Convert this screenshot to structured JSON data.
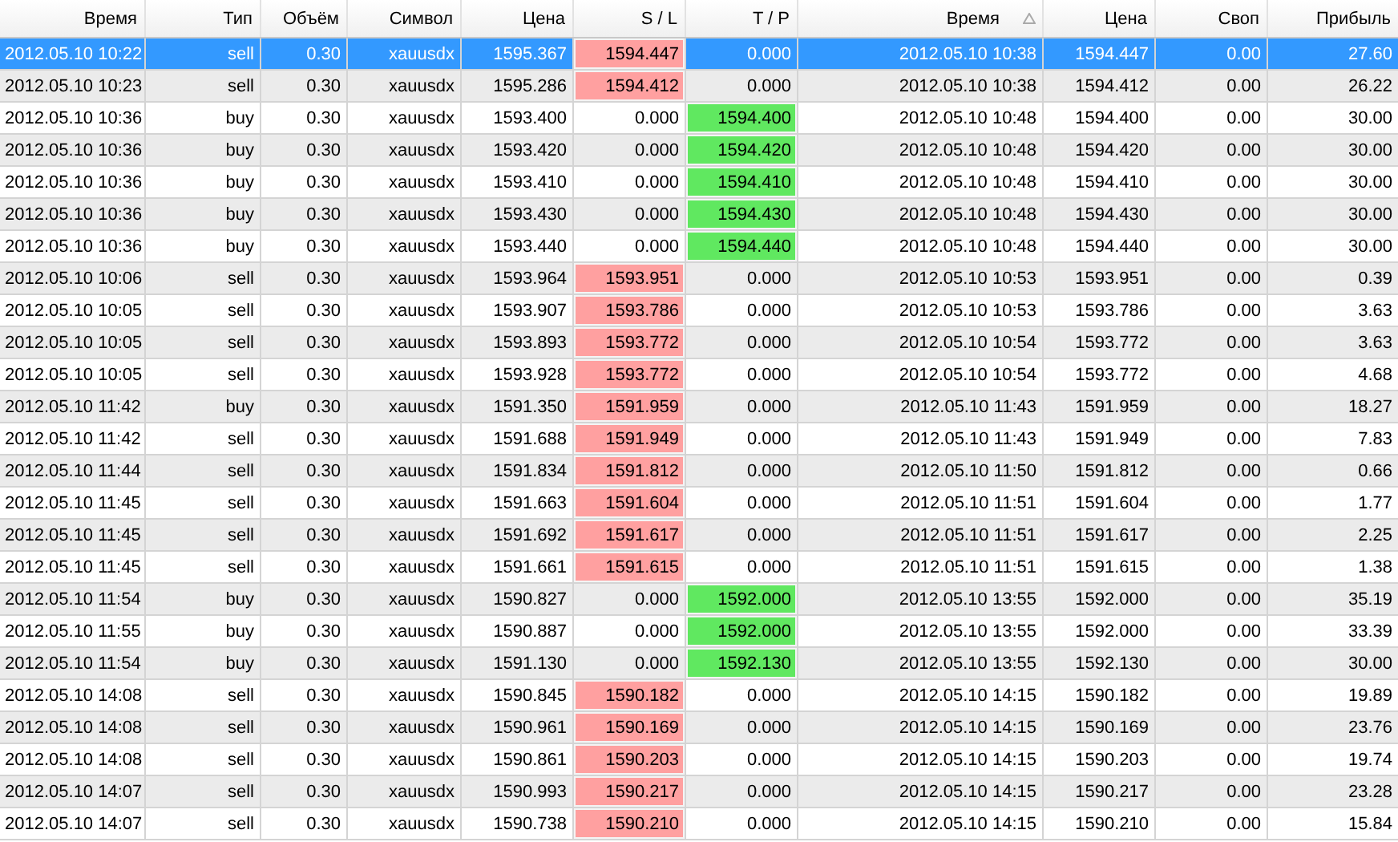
{
  "table": {
    "columns": [
      {
        "label": "Время",
        "sorted": false
      },
      {
        "label": "Тип",
        "sorted": false
      },
      {
        "label": "Объём",
        "sorted": false
      },
      {
        "label": "Символ",
        "sorted": false
      },
      {
        "label": "Цена",
        "sorted": false
      },
      {
        "label": "S / L",
        "sorted": false
      },
      {
        "label": "T / P",
        "sorted": false
      },
      {
        "label": "Время",
        "sorted": true
      },
      {
        "label": "Цена",
        "sorted": false
      },
      {
        "label": "Своп",
        "sorted": false
      },
      {
        "label": "Прибыль",
        "sorted": false
      }
    ],
    "rows": [
      {
        "cells": [
          "2012.05.10 10:22",
          "sell",
          "0.30",
          "xauusdx",
          "1595.367",
          "1594.447",
          "0.000",
          "2012.05.10 10:38",
          "1594.447",
          "0.00",
          "27.60"
        ],
        "selected": true,
        "sl_set": true,
        "tp_set": false
      },
      {
        "cells": [
          "2012.05.10 10:23",
          "sell",
          "0.30",
          "xauusdx",
          "1595.286",
          "1594.412",
          "0.000",
          "2012.05.10 10:38",
          "1594.412",
          "0.00",
          "26.22"
        ],
        "selected": false,
        "sl_set": true,
        "tp_set": false
      },
      {
        "cells": [
          "2012.05.10 10:36",
          "buy",
          "0.30",
          "xauusdx",
          "1593.400",
          "0.000",
          "1594.400",
          "2012.05.10 10:48",
          "1594.400",
          "0.00",
          "30.00"
        ],
        "selected": false,
        "sl_set": false,
        "tp_set": true
      },
      {
        "cells": [
          "2012.05.10 10:36",
          "buy",
          "0.30",
          "xauusdx",
          "1593.420",
          "0.000",
          "1594.420",
          "2012.05.10 10:48",
          "1594.420",
          "0.00",
          "30.00"
        ],
        "selected": false,
        "sl_set": false,
        "tp_set": true
      },
      {
        "cells": [
          "2012.05.10 10:36",
          "buy",
          "0.30",
          "xauusdx",
          "1593.410",
          "0.000",
          "1594.410",
          "2012.05.10 10:48",
          "1594.410",
          "0.00",
          "30.00"
        ],
        "selected": false,
        "sl_set": false,
        "tp_set": true
      },
      {
        "cells": [
          "2012.05.10 10:36",
          "buy",
          "0.30",
          "xauusdx",
          "1593.430",
          "0.000",
          "1594.430",
          "2012.05.10 10:48",
          "1594.430",
          "0.00",
          "30.00"
        ],
        "selected": false,
        "sl_set": false,
        "tp_set": true
      },
      {
        "cells": [
          "2012.05.10 10:36",
          "buy",
          "0.30",
          "xauusdx",
          "1593.440",
          "0.000",
          "1594.440",
          "2012.05.10 10:48",
          "1594.440",
          "0.00",
          "30.00"
        ],
        "selected": false,
        "sl_set": false,
        "tp_set": true
      },
      {
        "cells": [
          "2012.05.10 10:06",
          "sell",
          "0.30",
          "xauusdx",
          "1593.964",
          "1593.951",
          "0.000",
          "2012.05.10 10:53",
          "1593.951",
          "0.00",
          "0.39"
        ],
        "selected": false,
        "sl_set": true,
        "tp_set": false
      },
      {
        "cells": [
          "2012.05.10 10:05",
          "sell",
          "0.30",
          "xauusdx",
          "1593.907",
          "1593.786",
          "0.000",
          "2012.05.10 10:53",
          "1593.786",
          "0.00",
          "3.63"
        ],
        "selected": false,
        "sl_set": true,
        "tp_set": false
      },
      {
        "cells": [
          "2012.05.10 10:05",
          "sell",
          "0.30",
          "xauusdx",
          "1593.893",
          "1593.772",
          "0.000",
          "2012.05.10 10:54",
          "1593.772",
          "0.00",
          "3.63"
        ],
        "selected": false,
        "sl_set": true,
        "tp_set": false
      },
      {
        "cells": [
          "2012.05.10 10:05",
          "sell",
          "0.30",
          "xauusdx",
          "1593.928",
          "1593.772",
          "0.000",
          "2012.05.10 10:54",
          "1593.772",
          "0.00",
          "4.68"
        ],
        "selected": false,
        "sl_set": true,
        "tp_set": false
      },
      {
        "cells": [
          "2012.05.10 11:42",
          "buy",
          "0.30",
          "xauusdx",
          "1591.350",
          "1591.959",
          "0.000",
          "2012.05.10 11:43",
          "1591.959",
          "0.00",
          "18.27"
        ],
        "selected": false,
        "sl_set": true,
        "tp_set": false
      },
      {
        "cells": [
          "2012.05.10 11:42",
          "sell",
          "0.30",
          "xauusdx",
          "1591.688",
          "1591.949",
          "0.000",
          "2012.05.10 11:43",
          "1591.949",
          "0.00",
          "7.83"
        ],
        "selected": false,
        "sl_set": true,
        "tp_set": false
      },
      {
        "cells": [
          "2012.05.10 11:44",
          "sell",
          "0.30",
          "xauusdx",
          "1591.834",
          "1591.812",
          "0.000",
          "2012.05.10 11:50",
          "1591.812",
          "0.00",
          "0.66"
        ],
        "selected": false,
        "sl_set": true,
        "tp_set": false
      },
      {
        "cells": [
          "2012.05.10 11:45",
          "sell",
          "0.30",
          "xauusdx",
          "1591.663",
          "1591.604",
          "0.000",
          "2012.05.10 11:51",
          "1591.604",
          "0.00",
          "1.77"
        ],
        "selected": false,
        "sl_set": true,
        "tp_set": false
      },
      {
        "cells": [
          "2012.05.10 11:45",
          "sell",
          "0.30",
          "xauusdx",
          "1591.692",
          "1591.617",
          "0.000",
          "2012.05.10 11:51",
          "1591.617",
          "0.00",
          "2.25"
        ],
        "selected": false,
        "sl_set": true,
        "tp_set": false
      },
      {
        "cells": [
          "2012.05.10 11:45",
          "sell",
          "0.30",
          "xauusdx",
          "1591.661",
          "1591.615",
          "0.000",
          "2012.05.10 11:51",
          "1591.615",
          "0.00",
          "1.38"
        ],
        "selected": false,
        "sl_set": true,
        "tp_set": false
      },
      {
        "cells": [
          "2012.05.10 11:54",
          "buy",
          "0.30",
          "xauusdx",
          "1590.827",
          "0.000",
          "1592.000",
          "2012.05.10 13:55",
          "1592.000",
          "0.00",
          "35.19"
        ],
        "selected": false,
        "sl_set": false,
        "tp_set": true
      },
      {
        "cells": [
          "2012.05.10 11:55",
          "buy",
          "0.30",
          "xauusdx",
          "1590.887",
          "0.000",
          "1592.000",
          "2012.05.10 13:55",
          "1592.000",
          "0.00",
          "33.39"
        ],
        "selected": false,
        "sl_set": false,
        "tp_set": true
      },
      {
        "cells": [
          "2012.05.10 11:54",
          "buy",
          "0.30",
          "xauusdx",
          "1591.130",
          "0.000",
          "1592.130",
          "2012.05.10 13:55",
          "1592.130",
          "0.00",
          "30.00"
        ],
        "selected": false,
        "sl_set": false,
        "tp_set": true
      },
      {
        "cells": [
          "2012.05.10 14:08",
          "sell",
          "0.30",
          "xauusdx",
          "1590.845",
          "1590.182",
          "0.000",
          "2012.05.10 14:15",
          "1590.182",
          "0.00",
          "19.89"
        ],
        "selected": false,
        "sl_set": true,
        "tp_set": false
      },
      {
        "cells": [
          "2012.05.10 14:08",
          "sell",
          "0.30",
          "xauusdx",
          "1590.961",
          "1590.169",
          "0.000",
          "2012.05.10 14:15",
          "1590.169",
          "0.00",
          "23.76"
        ],
        "selected": false,
        "sl_set": true,
        "tp_set": false
      },
      {
        "cells": [
          "2012.05.10 14:08",
          "sell",
          "0.30",
          "xauusdx",
          "1590.861",
          "1590.203",
          "0.000",
          "2012.05.10 14:15",
          "1590.203",
          "0.00",
          "19.74"
        ],
        "selected": false,
        "sl_set": true,
        "tp_set": false
      },
      {
        "cells": [
          "2012.05.10 14:07",
          "sell",
          "0.30",
          "xauusdx",
          "1590.993",
          "1590.217",
          "0.000",
          "2012.05.10 14:15",
          "1590.217",
          "0.00",
          "23.28"
        ],
        "selected": false,
        "sl_set": true,
        "tp_set": false
      },
      {
        "cells": [
          "2012.05.10 14:07",
          "sell",
          "0.30",
          "xauusdx",
          "1590.738",
          "1590.210",
          "0.000",
          "2012.05.10 14:15",
          "1590.210",
          "0.00",
          "15.84"
        ],
        "selected": false,
        "sl_set": true,
        "tp_set": false
      }
    ]
  }
}
